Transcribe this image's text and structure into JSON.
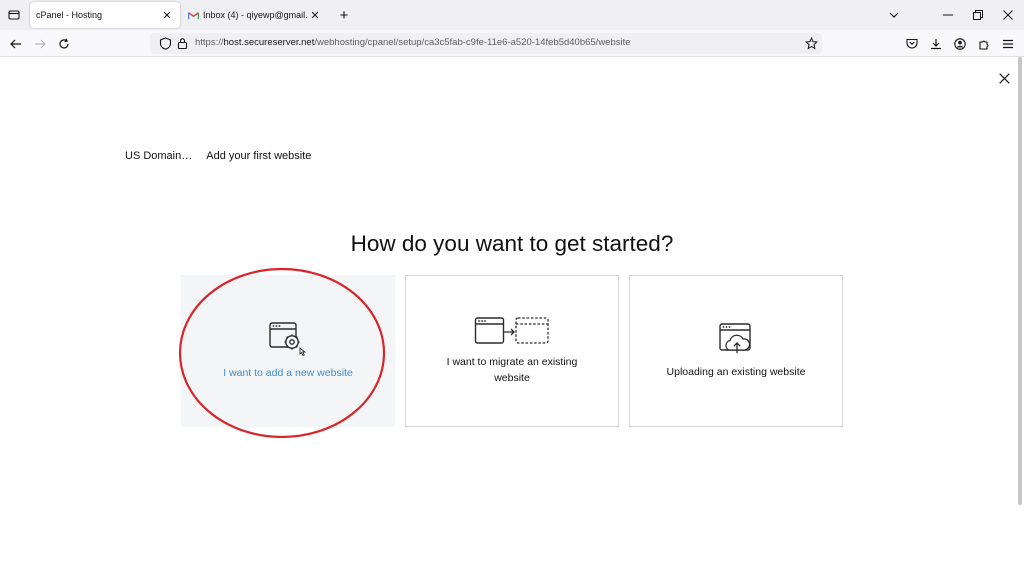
{
  "browser": {
    "tabs": [
      {
        "title": "cPanel - Hosting",
        "active": true
      },
      {
        "title": "Inbox (4) - qiyewp@gmail.com",
        "active": false
      }
    ],
    "url": {
      "scheme": "https://",
      "host": "host.secureserver.net",
      "path": "/webhosting/cpanel/setup/ca3c5fab-c9fe-11e6-a520-14feb5d40b65/website"
    }
  },
  "page": {
    "breadcrumb": [
      "US Domain…",
      "Add your first website"
    ],
    "heading": "How do you want to get started?",
    "options": [
      {
        "label": "I want to add a new website",
        "icon": "browser-gear-icon",
        "selected": true
      },
      {
        "label": "I want to migrate an existing website",
        "icon": "browser-migrate-icon",
        "selected": false
      },
      {
        "label": "Uploading an existing website",
        "icon": "browser-upload-icon",
        "selected": false
      }
    ]
  },
  "colors": {
    "selected_label": "#3a8ecf",
    "annotation_circle": "#d9242a",
    "selected_card_bg": "#f4f5f7"
  }
}
